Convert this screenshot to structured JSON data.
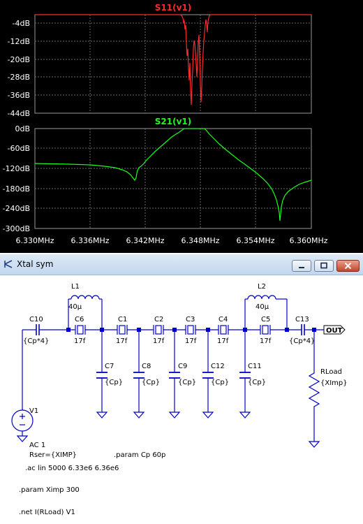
{
  "plot": {
    "s11_label": "S11(v1)",
    "s21_label": "S21(v1)",
    "s11_color": "#ff2a2a",
    "s21_color": "#1aff1a",
    "s11_ticks": [
      "-4dB",
      "-12dB",
      "-20dB",
      "-28dB",
      "-36dB",
      "-44dB"
    ],
    "s21_ticks": [
      "0dB",
      "-60dB",
      "-120dB",
      "-180dB",
      "-240dB",
      "-300dB"
    ],
    "x_ticks": [
      "6.330MHz",
      "6.336MHz",
      "6.342MHz",
      "6.348MHz",
      "6.354MHz",
      "6.360MHz"
    ]
  },
  "window": {
    "title": "Xtal sym",
    "icon": "schematic-icon",
    "min_icon": "minimize-icon",
    "max_icon": "maximize-icon",
    "close_icon": "close-icon"
  },
  "schematic": {
    "wire_color": "#0000cc",
    "components": {
      "L1": {
        "name": "L1",
        "value": "40µ"
      },
      "L2": {
        "name": "L2",
        "value": "40µ"
      },
      "C10": {
        "name": "C10",
        "value": "{Cp*4}"
      },
      "C6": {
        "name": "C6",
        "value": "17f"
      },
      "C1": {
        "name": "C1",
        "value": "17f"
      },
      "C2": {
        "name": "C2",
        "value": "17f"
      },
      "C3": {
        "name": "C3",
        "value": "17f"
      },
      "C4": {
        "name": "C4",
        "value": "17f"
      },
      "C5": {
        "name": "C5",
        "value": "17f"
      },
      "C13": {
        "name": "C13",
        "value": "{Cp*4}"
      },
      "C7": {
        "name": "C7",
        "value": "{Cp}"
      },
      "C8": {
        "name": "C8",
        "value": "{Cp}"
      },
      "C9": {
        "name": "C9",
        "value": "{Cp}"
      },
      "C12": {
        "name": "C12",
        "value": "{Cp}"
      },
      "C11": {
        "name": "C11",
        "value": "{Cp}"
      },
      "RLoad": {
        "name": "RLoad",
        "value": "{XImp}"
      },
      "V1": {
        "name": "V1",
        "value1": "AC 1",
        "value2": "Rser={XIMP}"
      }
    },
    "out_label": "OUT",
    "directives": {
      "param_cp": ".param Cp 60p",
      "ac": ".ac lin 5000 6.33e6 6.36e6",
      "param_ximp": ".param Ximp 300",
      "net": ".net I(RLoad) V1"
    }
  }
}
